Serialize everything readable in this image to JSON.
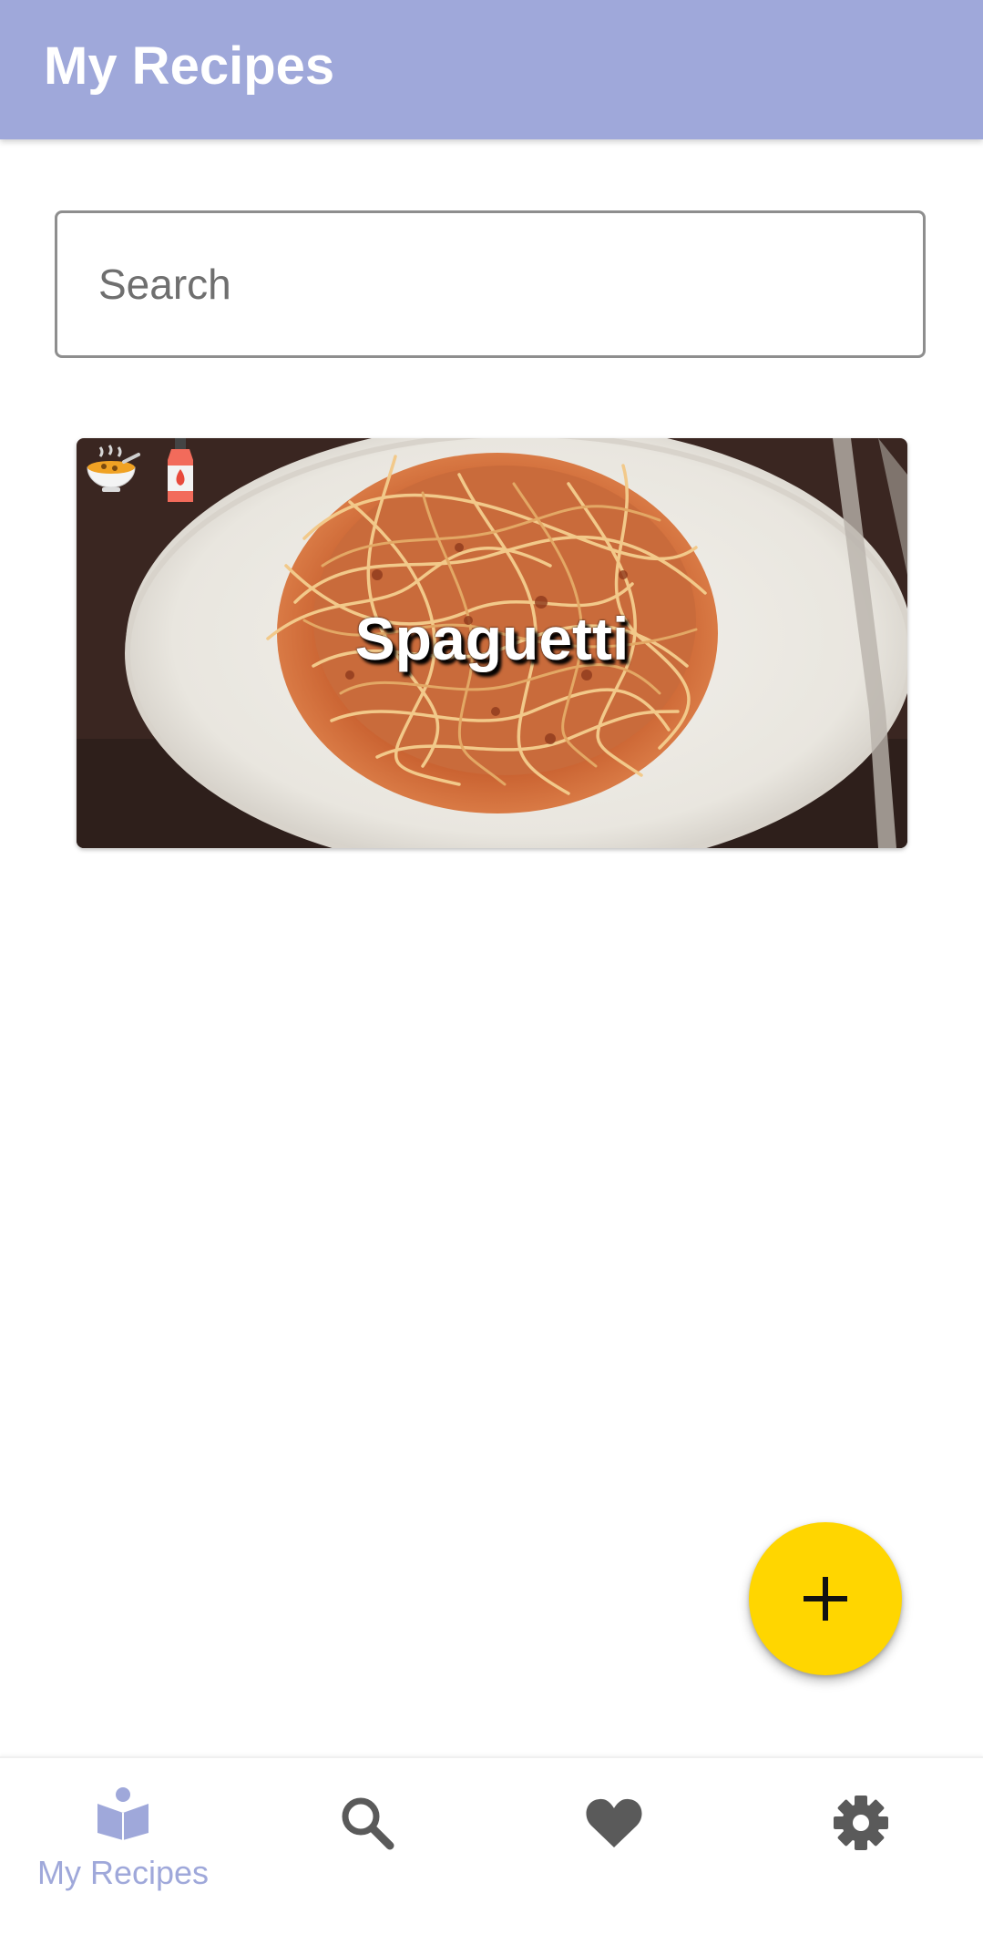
{
  "app_bar": {
    "title": "My Recipes",
    "color": "#9fa8da"
  },
  "search": {
    "placeholder": "Search",
    "value": ""
  },
  "recipes": [
    {
      "title": "Spaguetti",
      "tag_icons": [
        "soup-bowl-icon",
        "hot-sauce-bottle-icon"
      ]
    }
  ],
  "fab": {
    "icon": "plus-icon",
    "color": "#ffd600"
  },
  "bottom_nav": {
    "active_color": "#9fa8da",
    "inactive_color": "#5a5a5a",
    "items": [
      {
        "label": "My Recipes",
        "icon": "reading-book-icon",
        "active": true
      },
      {
        "icon": "search-icon",
        "active": false
      },
      {
        "icon": "heart-icon",
        "active": false
      },
      {
        "icon": "gear-icon",
        "active": false
      }
    ]
  }
}
